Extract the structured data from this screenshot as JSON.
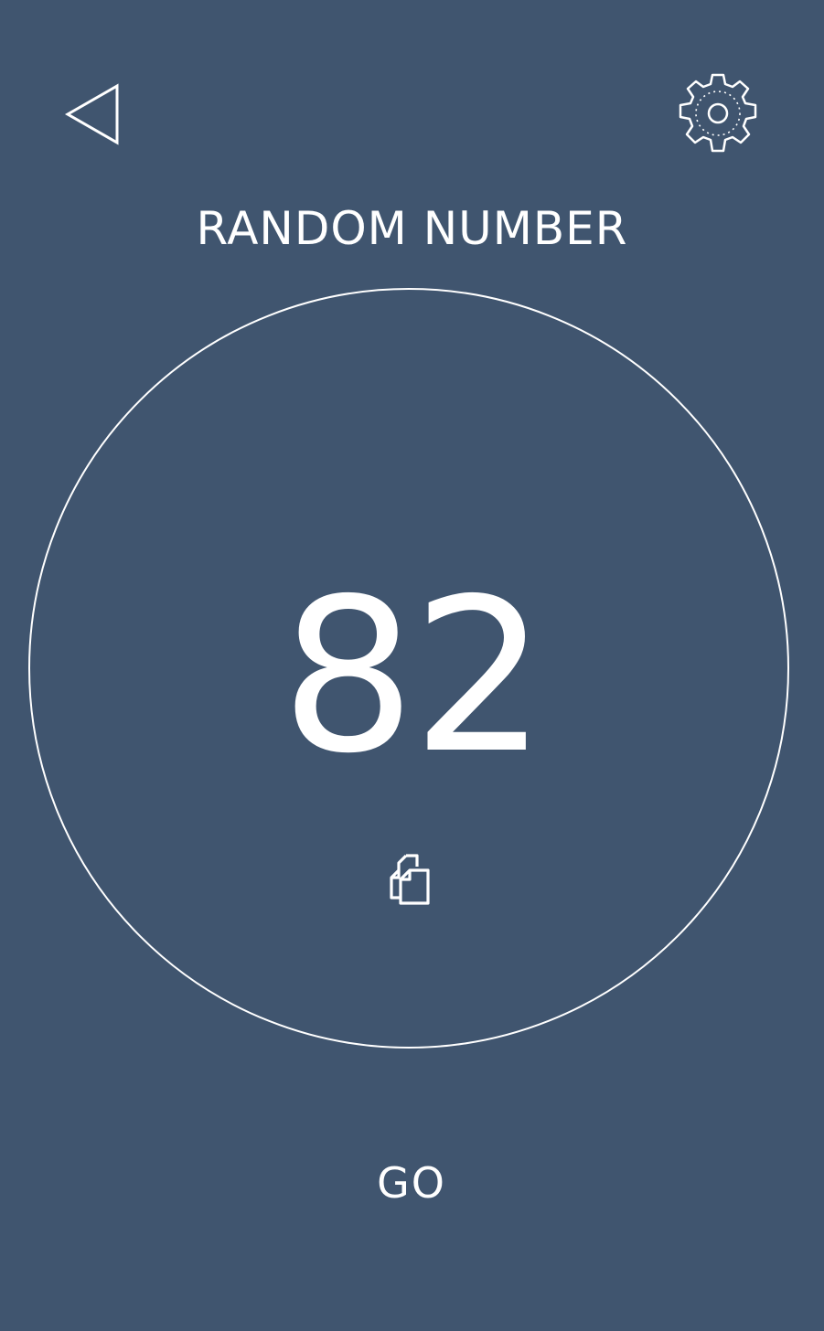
{
  "header": {
    "back_icon": "back-triangle-icon",
    "settings_icon": "gear-icon"
  },
  "title": "RANDOM NUMBER",
  "result": {
    "value": "82",
    "copy_icon": "copy-icon"
  },
  "actions": {
    "go_label": "GO"
  },
  "colors": {
    "background": "#40556f",
    "foreground": "#ffffff"
  }
}
